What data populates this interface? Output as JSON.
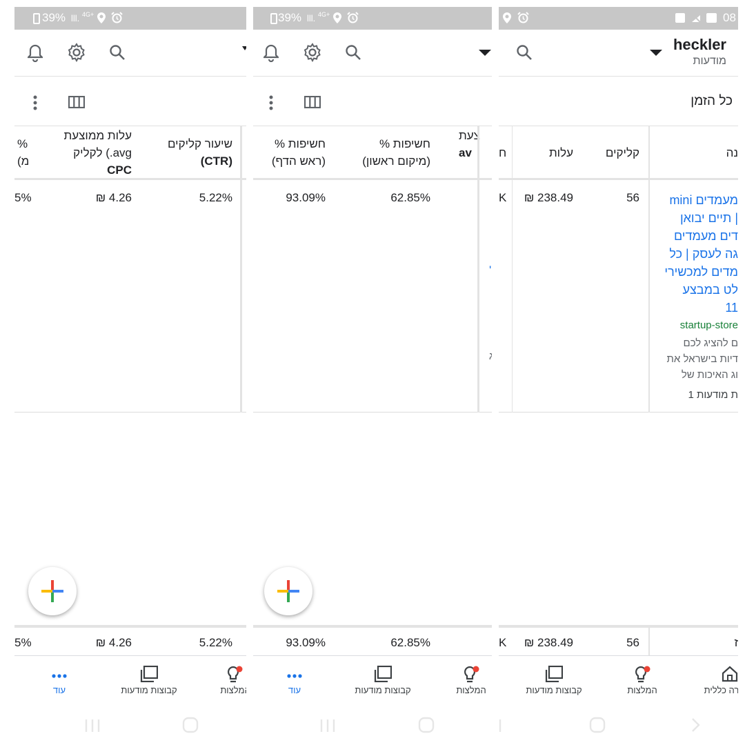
{
  "status": {
    "battery_p1": "39%",
    "battery_p2": "39%",
    "net": "4G+",
    "time_partial": "08"
  },
  "header": {
    "account_name": "heckler",
    "account_sub": "מודעות",
    "date_range": "כל הזמן"
  },
  "columns": {
    "ctr": [
      "שיעור קליקים",
      "(CTR)"
    ],
    "avg_cpc": [
      "עלות ממוצעת",
      "לקליק (.avg",
      "CPC"
    ],
    "partial_p1": [
      "%",
      "(מ"
    ],
    "abs_top": [
      "% חשיפות",
      "(ראש הדף)"
    ],
    "top": [
      "% חשיפות",
      "(מיקום ראשון)"
    ],
    "partial_p2": [
      "צעת",
      "av"
    ],
    "partial_p2_left": "ח",
    "clicks": "קליקים",
    "cost": "עלות",
    "ad": "נה"
  },
  "row": {
    "ctr": "5.22%",
    "avg_cpc": "₪ 4.26",
    "partial_p1": "5%",
    "abs_top": "93.09%",
    "top": "62.85%",
    "partial_k": "K",
    "clicks": "56",
    "cost": "₪ 238.49",
    "ad_headline_lines": [
      "mini מעמדים",
      "תיים יבואן |",
      "דים מעמדים",
      "גה לעסק | כל",
      "מדים למכשירי",
      "לט במבצע",
      "11"
    ],
    "ad_url": "startup-store",
    "ad_desc_lines": [
      "ם להציג לכם",
      "דיות בישראל את",
      "וג האיכות של"
    ],
    "ad_group": "ת מודעות 1",
    "p2_partial_mark1": "'",
    "p2_partial_mark2": "ג"
  },
  "totals": {
    "ctr": "5.22%",
    "avg_cpc": "₪ 4.26",
    "partial_p1": "5%",
    "abs_top": "93.09%",
    "top": "62.85%",
    "partial_k": "K",
    "clicks": "56",
    "cost": "₪ 238.49",
    "partial_end": "ז"
  },
  "nav": {
    "more": "עוד",
    "ad_groups": "קבוצות מודעות",
    "recommendations": "המלצות",
    "recommendations_partial": "המלצות",
    "overview_partial": "רה כללית"
  },
  "colors": {
    "accent": "#1a73e8",
    "url_green": "#188038",
    "badge_red": "#ea4335",
    "statusbar": "#c7c7c7"
  }
}
